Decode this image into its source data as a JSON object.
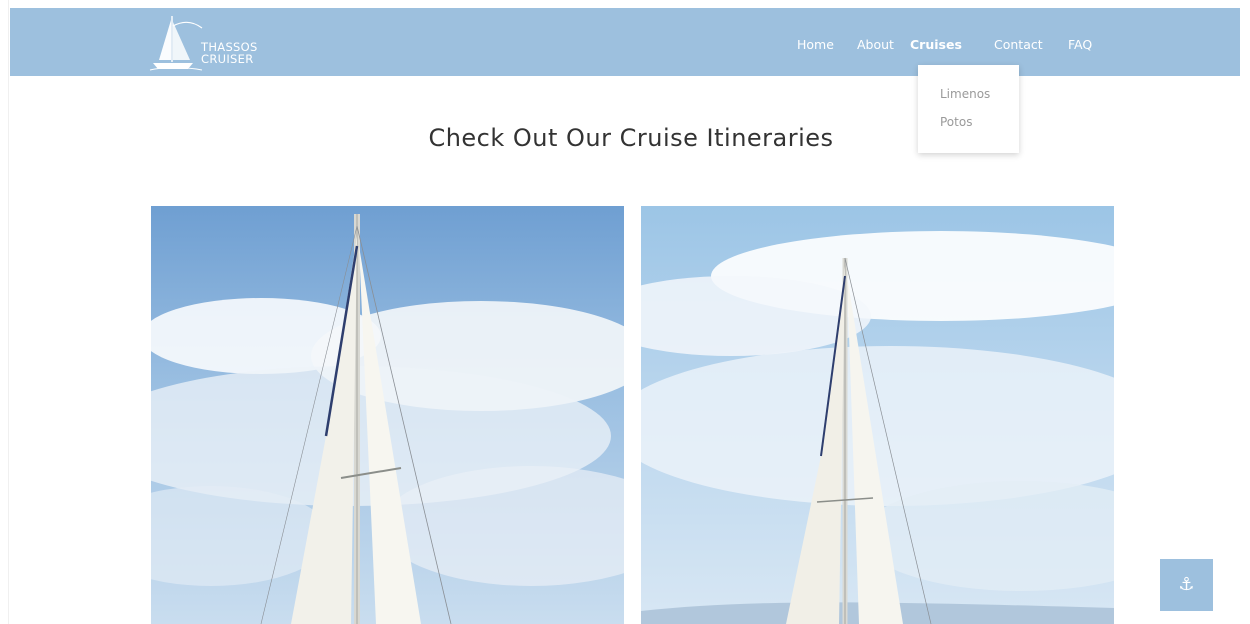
{
  "brand": {
    "line1": "THASSOS",
    "line2": "CRUISER",
    "icon": "sailboat-icon"
  },
  "nav": {
    "home": "Home",
    "about": "About",
    "cruises": "Cruises",
    "contact": "Contact",
    "faq": "FAQ",
    "active": "Cruises"
  },
  "dropdown": {
    "items": [
      "Limenos",
      "Potos"
    ]
  },
  "main": {
    "heading": "Check Out Our Cruise Itineraries"
  },
  "cards": [
    {
      "image": "sailboat-photo",
      "alt": "sailboat photo"
    },
    {
      "image": "sailboat-photo",
      "alt": "sailboat photo"
    }
  ],
  "back_to_top": {
    "icon": "anchor-icon",
    "glyph": "⚓"
  },
  "colors": {
    "navbar": "#9dc0de",
    "heading": "#333333",
    "dropdown_text": "#9a9a9a",
    "button": "#9dc0de"
  }
}
